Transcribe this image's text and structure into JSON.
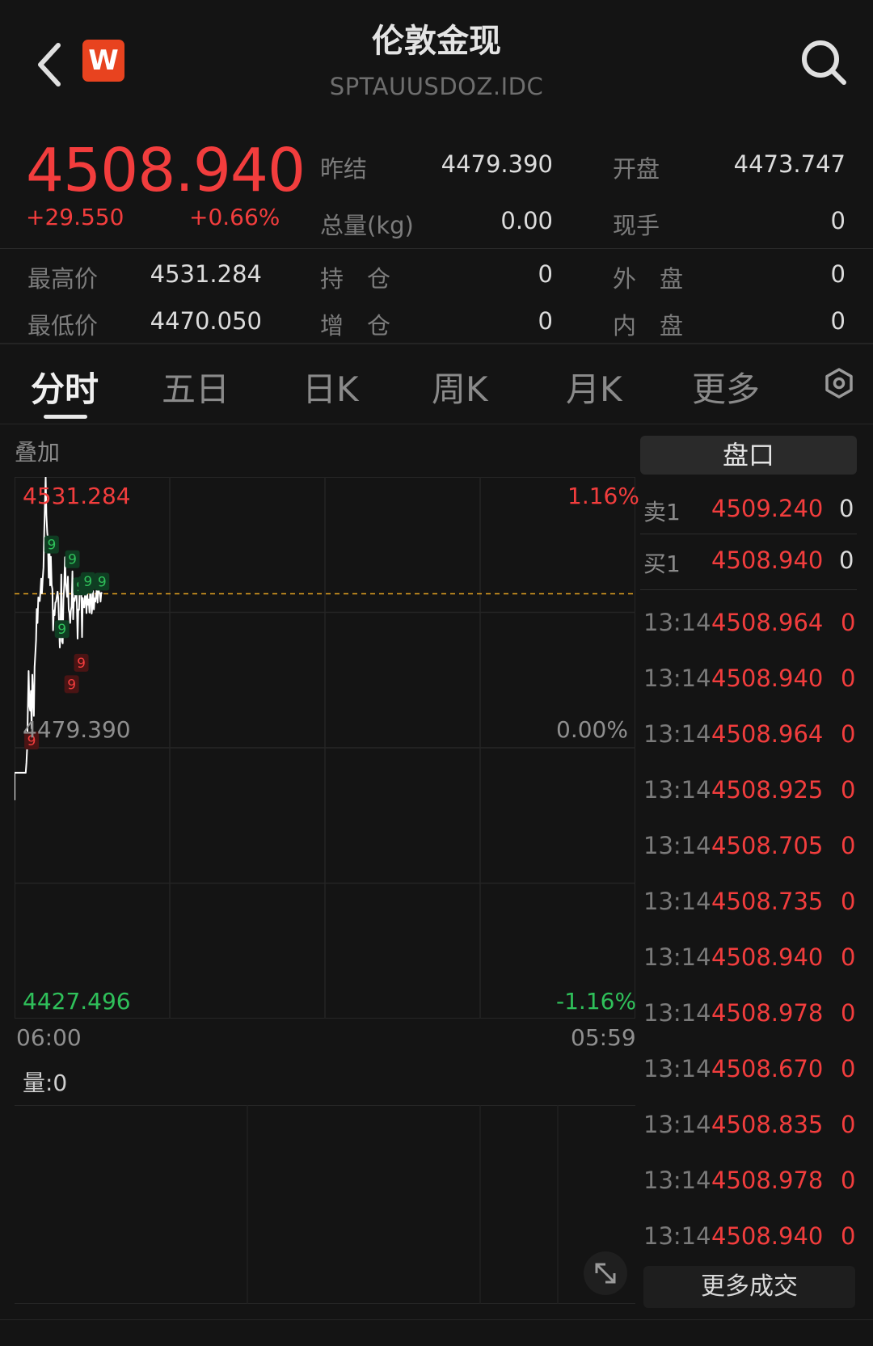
{
  "header": {
    "title": "伦敦金现",
    "code": "SPTAUUSDOZ.IDC",
    "brand_letter": "W",
    "brand_color": "#e8431f"
  },
  "quote": {
    "last_price": "4508.940",
    "change": "+29.550",
    "change_pct": "+0.66%",
    "stats": {
      "prev_settle_label": "昨结",
      "prev_settle": "4479.390",
      "open_label": "开盘",
      "open": "4473.747",
      "volume_label": "总量(kg)",
      "volume": "0.00",
      "current_hand_label": "现手",
      "current_hand": "0",
      "high_label": "最高价",
      "high": "4531.284",
      "position_label": "持　仓",
      "position": "0",
      "outer_label": "外　盘",
      "outer": "0",
      "low_label": "最低价",
      "low": "4470.050",
      "add_position_label": "增　仓",
      "add_position": "0",
      "inner_label": "内　盘",
      "inner": "0"
    }
  },
  "tabs": [
    {
      "label": "分时",
      "active": true
    },
    {
      "label": "五日",
      "active": false
    },
    {
      "label": "日K",
      "active": false
    },
    {
      "label": "周K",
      "active": false
    },
    {
      "label": "月K",
      "active": false
    },
    {
      "label": "更多",
      "active": false
    }
  ],
  "chart": {
    "overlay_label": "叠加",
    "price_top": "4531.284",
    "pct_top": "1.16%",
    "price_mid": "4479.390",
    "pct_mid": "0.00%",
    "price_bottom": "4427.496",
    "pct_bottom": "-1.16%",
    "time_start": "06:00",
    "time_end": "05:59",
    "volume_label": "量:0",
    "signal_label": "9"
  },
  "chart_data": {
    "type": "line",
    "title": "",
    "ylim": [
      4427.496,
      4531.284
    ],
    "reference": 4479.39,
    "x": [
      0,
      1,
      2,
      3,
      4,
      5,
      6,
      7,
      8,
      9,
      10,
      11,
      12,
      13,
      14,
      15,
      16,
      17,
      18,
      19,
      20,
      21,
      22,
      23,
      24,
      25,
      26,
      27,
      28,
      29,
      30,
      31,
      32,
      33,
      34,
      35,
      36,
      37,
      38,
      39,
      40,
      41,
      42,
      43,
      44,
      45,
      46,
      47,
      48,
      49,
      50,
      51,
      52,
      53,
      54,
      55,
      56,
      57,
      58,
      59,
      60,
      61,
      62,
      63,
      64,
      65,
      66,
      67,
      68,
      69,
      70,
      71,
      72,
      73,
      74,
      75,
      76,
      77,
      78,
      79,
      80,
      81,
      82,
      83,
      84,
      85,
      86,
      87,
      88,
      89,
      90,
      91,
      92,
      93,
      94,
      95,
      96,
      97,
      98,
      99,
      100,
      101,
      102,
      103,
      104,
      105,
      106,
      107,
      108,
      109,
      110,
      111,
      112,
      113,
      114,
      115,
      116,
      117,
      118
    ],
    "values": [
      4474.6,
      4474.6,
      4474.6,
      4474.6,
      4474.6,
      4474.6,
      4474.6,
      4474.6,
      4474.6,
      4474.6,
      4474.6,
      4474.6,
      4474.6,
      4474.6,
      4474.6,
      4474.6,
      4476.5,
      4479.4,
      4487.0,
      4494.1,
      4487.6,
      4486.5,
      4490.3,
      4483.1,
      4493.4,
      4489.1,
      4485.5,
      4494.9,
      4497.4,
      4500.0,
      4506.0,
      4503.3,
      4508.2,
      4507.5,
      4507.5,
      4509.5,
      4511.8,
      4509.0,
      4511.9,
      4513.9,
      4520.6,
      4526.0,
      4531.2,
      4523.9,
      4520.7,
      4519.3,
      4512.0,
      4518.4,
      4510.5,
      4516.0,
      4510.6,
      4509.8,
      4501.9,
      4505.7,
      4504.8,
      4507.2,
      4507.4,
      4508.4,
      4509.3,
      4508.0,
      4503.4,
      4498.6,
      4502.7,
      4512.6,
      4499.8,
      4499.4,
      4507.8,
      4510.6,
      4515.9,
      4511.1,
      4509.5,
      4508.3,
      4512.2,
      4505.9,
      4505.2,
      4503.3,
      4505.7,
      4506.5,
      4513.2,
      4504.0,
      4508.0,
      4507.5,
      4508.6,
      4511.3,
      4506.8,
      4500.3,
      4505.9,
      4505.8,
      4510.6,
      4509.4,
      4509.1,
      4500.6,
      4508.1,
      4506.4,
      4506.3,
      4508.5,
      4508.3,
      4505.2,
      4509.3,
      4506.8,
      4507.8,
      4505.3,
      4510.0,
      4509.5,
      4505.1,
      4506.4,
      4509.4,
      4505.9,
      4508.0,
      4507.4,
      4508.7,
      4509.8,
      4507.2,
      4510.1,
      4509.2,
      4509.0,
      4507.4,
      4509.1,
      4508.9
    ],
    "signals": [
      {
        "x": 42,
        "value": 4531.2,
        "type": "top"
      },
      {
        "x": 50,
        "value": 4516.0,
        "type": "top"
      },
      {
        "x": 64,
        "value": 4499.8,
        "type": "top"
      },
      {
        "x": 78,
        "value": 4513.2,
        "type": "top"
      },
      {
        "x": 89,
        "value": 4508.0,
        "type": "top"
      },
      {
        "x": 96,
        "value": 4508.3,
        "type": "top"
      },
      {
        "x": 99,
        "value": 4509.0,
        "type": "top"
      },
      {
        "x": 118,
        "value": 4508.9,
        "type": "top"
      },
      {
        "x": 23,
        "value": 4483.1,
        "type": "bottom"
      },
      {
        "x": 77,
        "value": 4493.9,
        "type": "bottom"
      },
      {
        "x": 90,
        "value": 4498.0,
        "type": "bottom"
      }
    ]
  },
  "order_book": {
    "title": "盘口",
    "ask_label": "卖1",
    "ask_price": "4509.240",
    "ask_vol": "0",
    "bid_label": "买1",
    "bid_price": "4508.940",
    "bid_vol": "0"
  },
  "ticks": [
    {
      "time": "13:14",
      "price": "4508.964",
      "vol": "0"
    },
    {
      "time": "13:14",
      "price": "4508.940",
      "vol": "0"
    },
    {
      "time": "13:14",
      "price": "4508.964",
      "vol": "0"
    },
    {
      "time": "13:14",
      "price": "4508.925",
      "vol": "0"
    },
    {
      "time": "13:14",
      "price": "4508.705",
      "vol": "0"
    },
    {
      "time": "13:14",
      "price": "4508.735",
      "vol": "0"
    },
    {
      "time": "13:14",
      "price": "4508.940",
      "vol": "0"
    },
    {
      "time": "13:14",
      "price": "4508.978",
      "vol": "0"
    },
    {
      "time": "13:14",
      "price": "4508.670",
      "vol": "0"
    },
    {
      "time": "13:14",
      "price": "4508.835",
      "vol": "0"
    },
    {
      "time": "13:14",
      "price": "4508.978",
      "vol": "0"
    },
    {
      "time": "13:14",
      "price": "4508.940",
      "vol": "0"
    }
  ],
  "more_trades_label": "更多成交",
  "colors": {
    "up": "#f23d3d",
    "down": "#2fc05a",
    "line": "#ffffff",
    "ref_line": "#e0a020",
    "background": "#141414"
  }
}
